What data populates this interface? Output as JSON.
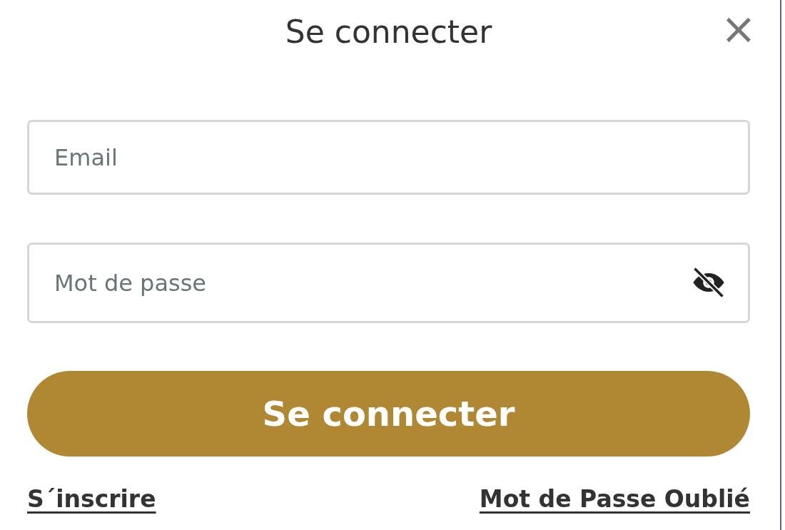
{
  "dialog": {
    "title": "Se connecter",
    "close": "×"
  },
  "fields": [
    {
      "kind": "email",
      "placeholder": "Email"
    },
    {
      "kind": "password",
      "placeholder": "Mot de passe",
      "password_visible": false
    }
  ],
  "submit_button": "Se connecter",
  "register_link": "S´inscrire",
  "forgot_password_link": "Mot de Passe Oublié"
}
